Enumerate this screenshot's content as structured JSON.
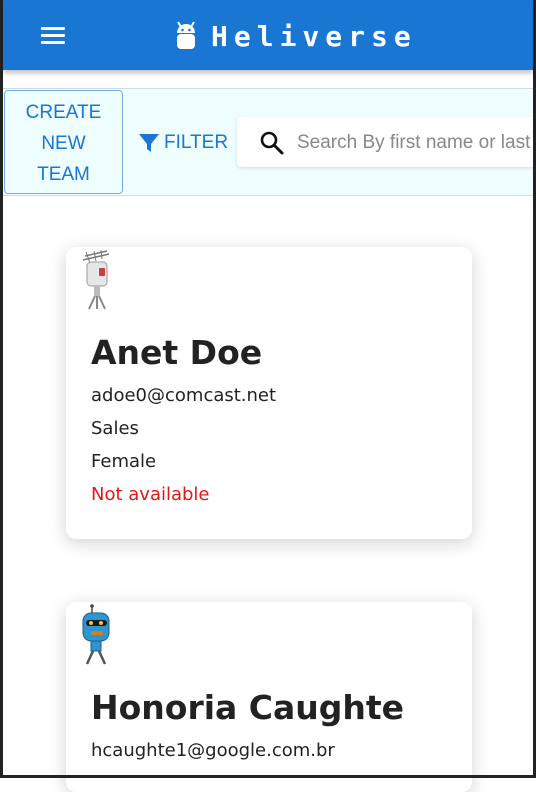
{
  "app": {
    "title": "Heliverse"
  },
  "icons": {
    "menu": "menu-icon",
    "brand": "android-icon",
    "filter": "filter-icon",
    "search": "search-icon"
  },
  "colors": {
    "primary": "#1976d2",
    "toolbar_bg": "#eefdfd",
    "unavailable": "#e01818"
  },
  "toolbar": {
    "create_team_line1": "CREATE",
    "create_team_line2": "NEW",
    "create_team_line3": "TEAM",
    "filter_label": "FILTER",
    "search_placeholder": "Search By first name or last name"
  },
  "users": [
    {
      "name": "Anet Doe",
      "email": "adoe0@comcast.net",
      "domain": "Sales",
      "gender": "Female",
      "availability": "Not available"
    },
    {
      "name": "Honoria Caughte",
      "email": "hcaughte1@google.com.br"
    }
  ]
}
